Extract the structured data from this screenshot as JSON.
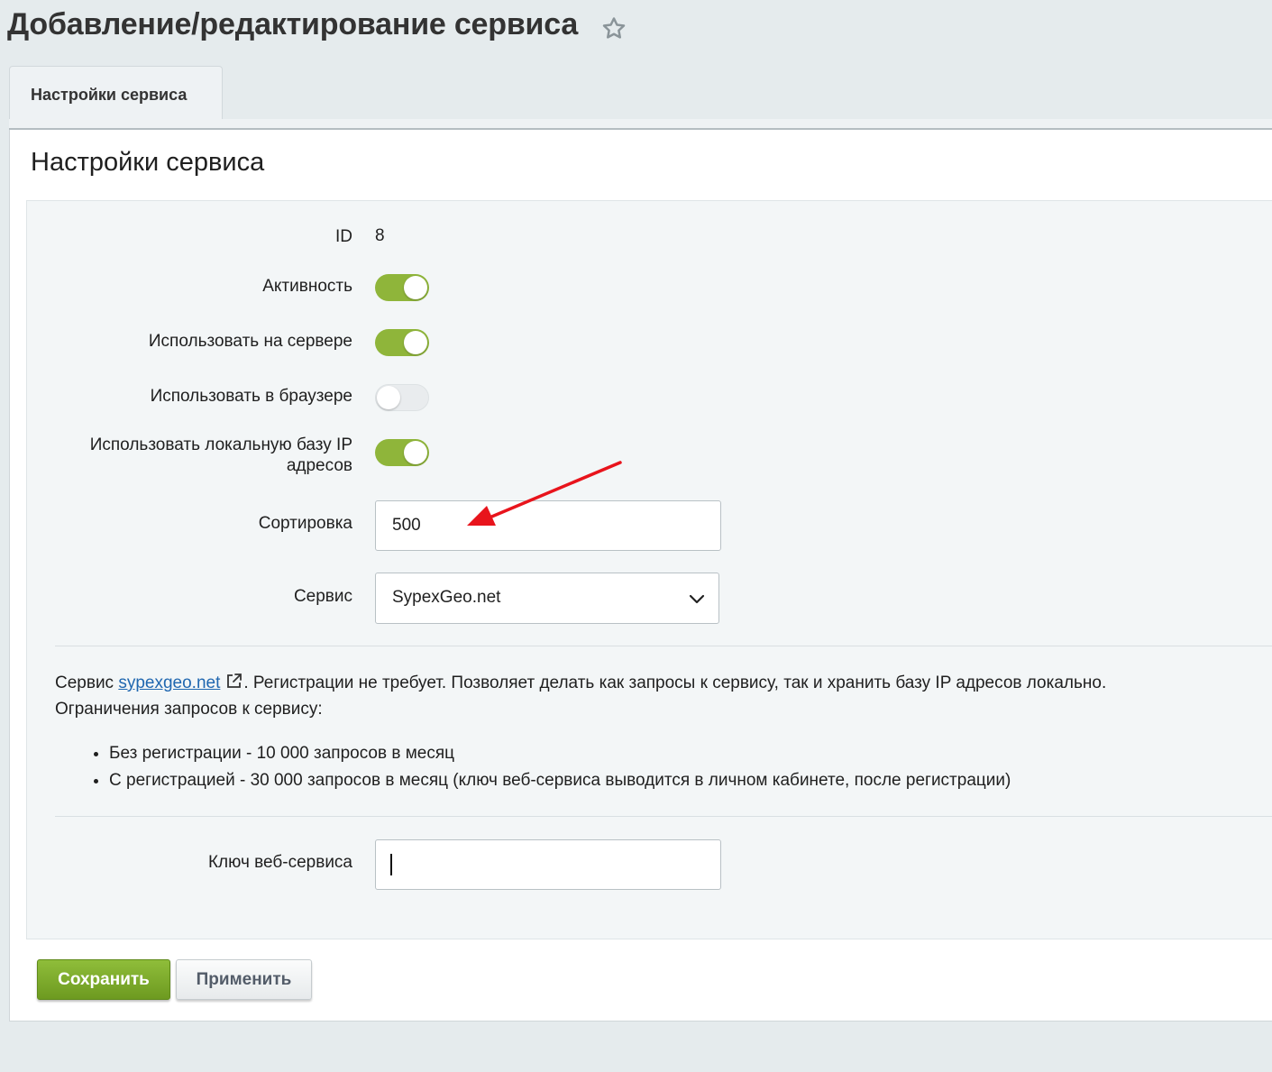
{
  "header": {
    "title": "Добавление/редактирование сервиса",
    "favorite_icon": "star-icon"
  },
  "tabs": [
    {
      "label": "Настройки сервиса",
      "active": true
    }
  ],
  "section": {
    "title": "Настройки сервиса"
  },
  "form": {
    "id_label": "ID",
    "id_value": "8",
    "active_label": "Активность",
    "active_on": true,
    "server_label": "Использовать на сервере",
    "server_on": true,
    "browser_label": "Использовать в браузере",
    "browser_on": false,
    "localdb_label_line1": "Использовать локальную базу IP",
    "localdb_label_line2": "адресов",
    "localdb_on": true,
    "sort_label": "Сортировка",
    "sort_value": "500",
    "service_label": "Сервис",
    "service_value": "SypexGeo.net",
    "key_label": "Ключ веб-сервиса",
    "key_value": ""
  },
  "description": {
    "prefix": "Сервис",
    "link_text": "sypexgeo.net",
    "text_after_link": ". Регистрации не требует. Позволяет делать как запросы к сервису, так и хранить базу IP адресов локально.",
    "line2": "Ограничения запросов к сервису:",
    "bullets": [
      "Без регистрации - 10 000 запросов в месяц",
      "С регистрацией - 30 000 запросов в месяц (ключ веб-сервиса выводится в личном кабинете, после регистрации)"
    ]
  },
  "buttons": {
    "save_label": "Сохранить",
    "apply_label": "Применить"
  },
  "colors": {
    "toggle_on": "#8fb53a",
    "save_button": "#7aa82a",
    "link": "#2067b0",
    "annotation_arrow": "#e8141c"
  }
}
